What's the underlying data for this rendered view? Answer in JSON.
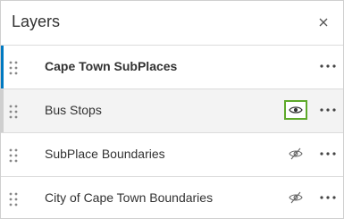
{
  "panel": {
    "title": "Layers",
    "close_icon": "close-icon"
  },
  "layers": [
    {
      "label": "Cape Town SubPlaces",
      "state": "selected",
      "visibility_icon": "none"
    },
    {
      "label": "Bus Stops",
      "state": "hover",
      "visibility_icon": "eye-icon"
    },
    {
      "label": "SubPlace Boundaries",
      "state": "normal",
      "visibility_icon": "eye-slash-icon"
    },
    {
      "label": "City of Cape Town Boundaries",
      "state": "normal",
      "visibility_icon": "eye-slash-icon"
    }
  ],
  "colors": {
    "accent_selected": "#0079c1",
    "highlight_box": "#5ea92a",
    "hover_background": "#f3f3f3"
  }
}
